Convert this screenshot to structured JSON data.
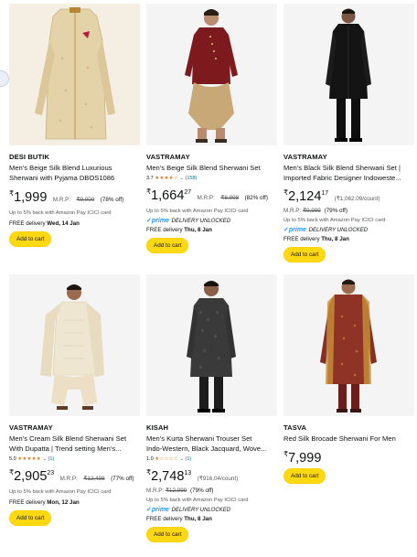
{
  "products": [
    {
      "brand": "DESI BUTIK",
      "title_line1": "Men's Beige Silk Blend Luxurious",
      "title_line2": "Sherwani with Pyjama DBOS1086",
      "price_symbol": "₹",
      "price_whole": "1,999",
      "price_fraction": "",
      "mrp_label": "M.R.P:",
      "mrp_value": "₹9,000",
      "discount": "(78% off)",
      "cashback": "Up to 5% back with Amazon Pay ICICI card",
      "delivery_prefix": "FREE delivery",
      "delivery_date": "Wed, 14 Jan",
      "cart_label": "Add to cart",
      "colors": {
        "bg": "#f5efe3",
        "garment": "#e4d2a8",
        "trim": "#b8862e"
      }
    },
    {
      "brand": "VASTRAMAY",
      "title_line1": "Men's Beige Silk Blend Sherwani Set",
      "rating": "3.7",
      "stars": "★★★★☆",
      "rating_count": "(158)",
      "price_symbol": "₹",
      "price_whole": "1,664",
      "price_fraction": "27",
      "mrp_label": "M.R.P:",
      "mrp_value": "₹8,998",
      "discount": "(82% off)",
      "cashback": "Up to 5% back with Amazon Pay ICICI card",
      "prime_label": "prime",
      "prime_note": "DELIVERY UNLOCKED",
      "delivery_prefix": "FREE delivery",
      "delivery_date": "Thu, 8 Jan",
      "cart_label": "Add to cart",
      "colors": {
        "bg": "#f4f4f4",
        "garment": "#7d1a1e",
        "trim": "#c9a878"
      }
    },
    {
      "brand": "VASTRAMAY",
      "title_line1": "Men's Black Silk Blend Sherwani Set |",
      "title_line2": "Imported Fabric Designer Indoweste...",
      "price_symbol": "₹",
      "price_whole": "2,124",
      "price_fraction": "17",
      "unit_price": "(₹1,062.09/count)",
      "mrp_label": "M.R.P:",
      "mrp_value": "₹9,999",
      "discount": "(79% off)",
      "cashback": "Up to 5% back with Amazon Pay ICICI card",
      "prime_label": "prime",
      "prime_note": "DELIVERY UNLOCKED",
      "delivery_prefix": "FREE delivery",
      "delivery_date": "Thu, 8 Jan",
      "cart_label": "Add to cart",
      "colors": {
        "bg": "#f4f4f4",
        "garment": "#141414",
        "trim": "#2a2a2a"
      }
    },
    {
      "brand": "VASTRAMAY",
      "title_line1": "Men's Cream Silk Blend Sherwani Set",
      "title_line2": "With Dupatta | Trend setting Men's...",
      "rating": "5.0",
      "stars": "★★★★★",
      "rating_count": "(1)",
      "price_symbol": "₹",
      "price_whole": "2,905",
      "price_fraction": "23",
      "mrp_label": "M.R.P:",
      "mrp_value": "₹12,498",
      "discount": "(77% off)",
      "cashback": "Up to 5% back with Amazon Pay ICICI card",
      "delivery_prefix": "FREE delivery",
      "delivery_date": "Mon, 12 Jan",
      "cart_label": "Add to cart",
      "colors": {
        "bg": "#f4f4f4",
        "garment": "#efe6d2",
        "trim": "#d9c9a4"
      }
    },
    {
      "brand": "KISAH",
      "title_line1": "Men's Kurta Sherwani Trouser Set",
      "title_line2": "Indo-Western, Black Jacquard, Wove...",
      "rating": "1.0",
      "stars": "★☆☆☆☆",
      "rating_count": "(1)",
      "price_symbol": "₹",
      "price_whole": "2,748",
      "price_fraction": "13",
      "unit_price": "(₹916.04/count)",
      "mrp_label": "M.R.P:",
      "mrp_value": "₹12,999",
      "discount": "(79% off)",
      "cashback": "Up to 5% back with Amazon Pay ICICI card",
      "prime_label": "prime",
      "prime_note": "DELIVERY UNLOCKED",
      "delivery_prefix": "FREE delivery",
      "delivery_date": "Thu, 8 Jan",
      "cart_label": "Add to cart",
      "colors": {
        "bg": "#f4f4f4",
        "garment": "#3a3a3a",
        "trim": "#1d1d1d"
      }
    },
    {
      "brand": "TASVA",
      "title_line1": "Red Silk Brocade Sherwani For Men",
      "price_symbol": "₹",
      "price_whole": "7,999",
      "price_fraction": "",
      "cart_label": "Add to cart",
      "colors": {
        "bg": "#f4f4f4",
        "garment": "#8e3325",
        "trim": "#c9913a"
      }
    }
  ]
}
